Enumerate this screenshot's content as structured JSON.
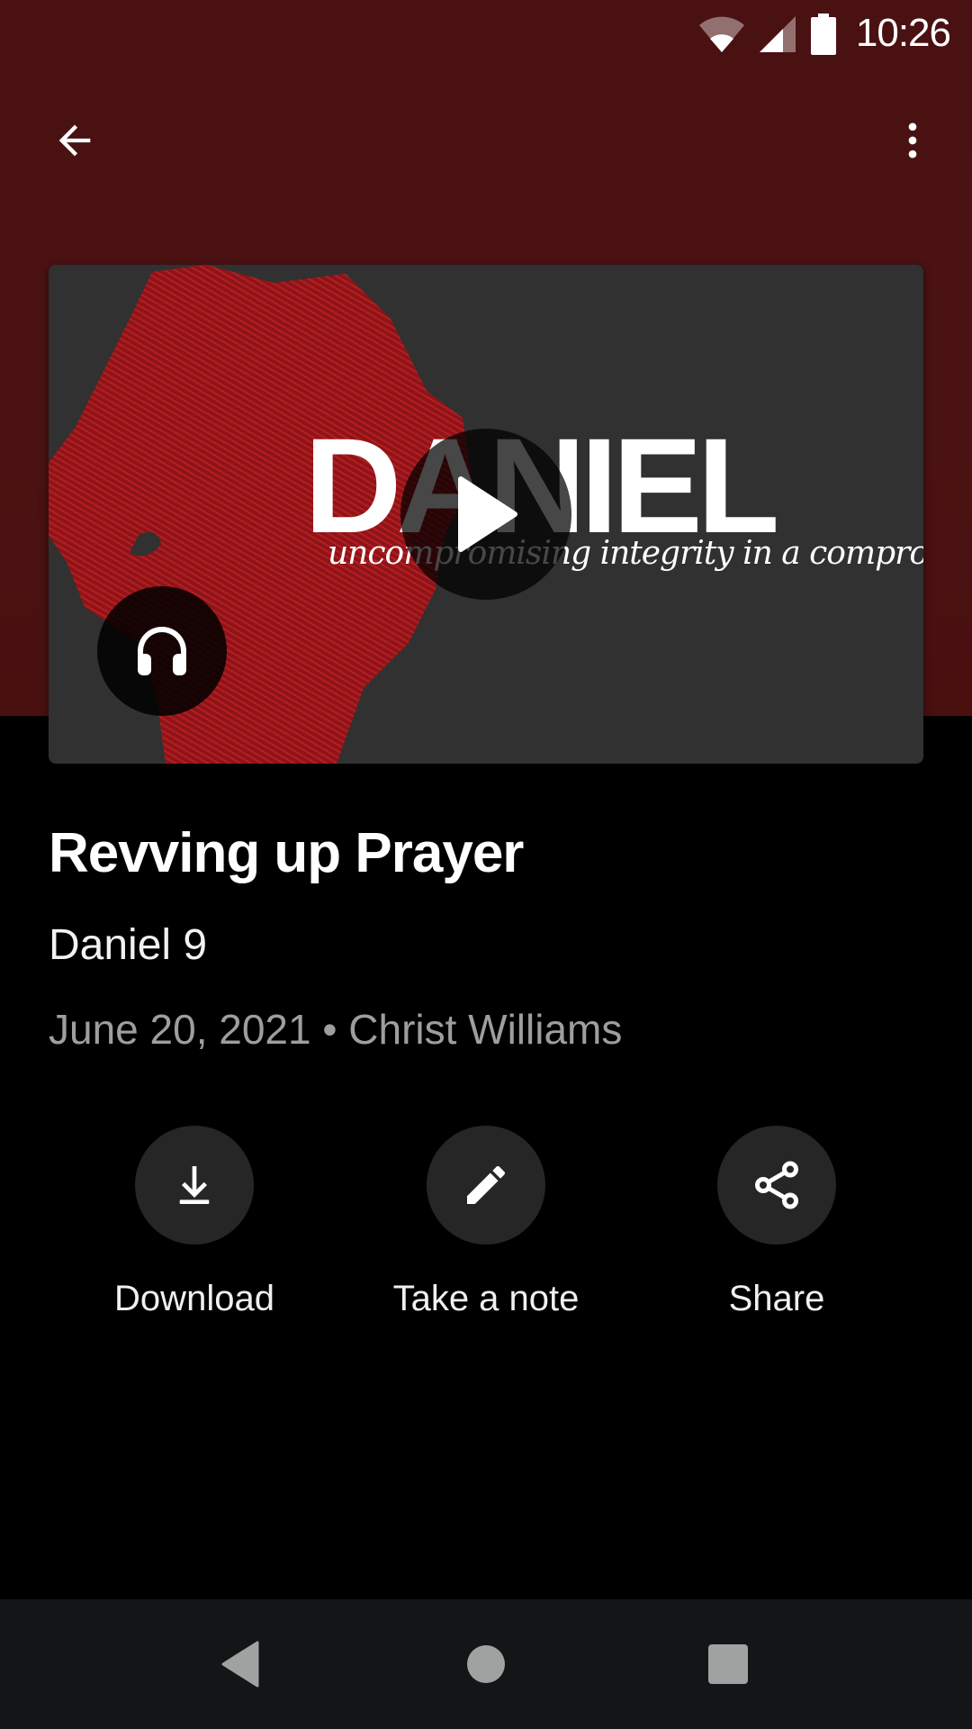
{
  "status_bar": {
    "time": "10:26",
    "icons": [
      "wifi-icon",
      "cellular-signal-icon",
      "battery-icon"
    ]
  },
  "toolbar": {
    "back_icon": "arrow-back-icon",
    "menu_icon": "more-vert-icon"
  },
  "artwork": {
    "series_title": "DANIEL",
    "tagline": "uncompromising integrity in a compromised world",
    "play_icon": "play-icon",
    "audio_icon": "headphones-icon"
  },
  "sermon": {
    "title": "Revving up Prayer",
    "passage": "Daniel 9",
    "date": "June 20, 2021",
    "separator": "•",
    "speaker": "Christ Williams"
  },
  "actions": [
    {
      "label": "Download",
      "icon": "download-icon"
    },
    {
      "label": "Take a note",
      "icon": "pencil-icon"
    },
    {
      "label": "Share",
      "icon": "share-icon"
    }
  ],
  "nav_bar": {
    "back": "nav-back-icon",
    "home": "nav-home-icon",
    "recents": "nav-recents-icon"
  },
  "colors": {
    "header_bg": "#4a1112",
    "page_bg": "#000000",
    "action_circle": "#262626",
    "meta_text": "#9e9e9e",
    "nav_bg": "#141517",
    "art_red": "#a0181c"
  }
}
